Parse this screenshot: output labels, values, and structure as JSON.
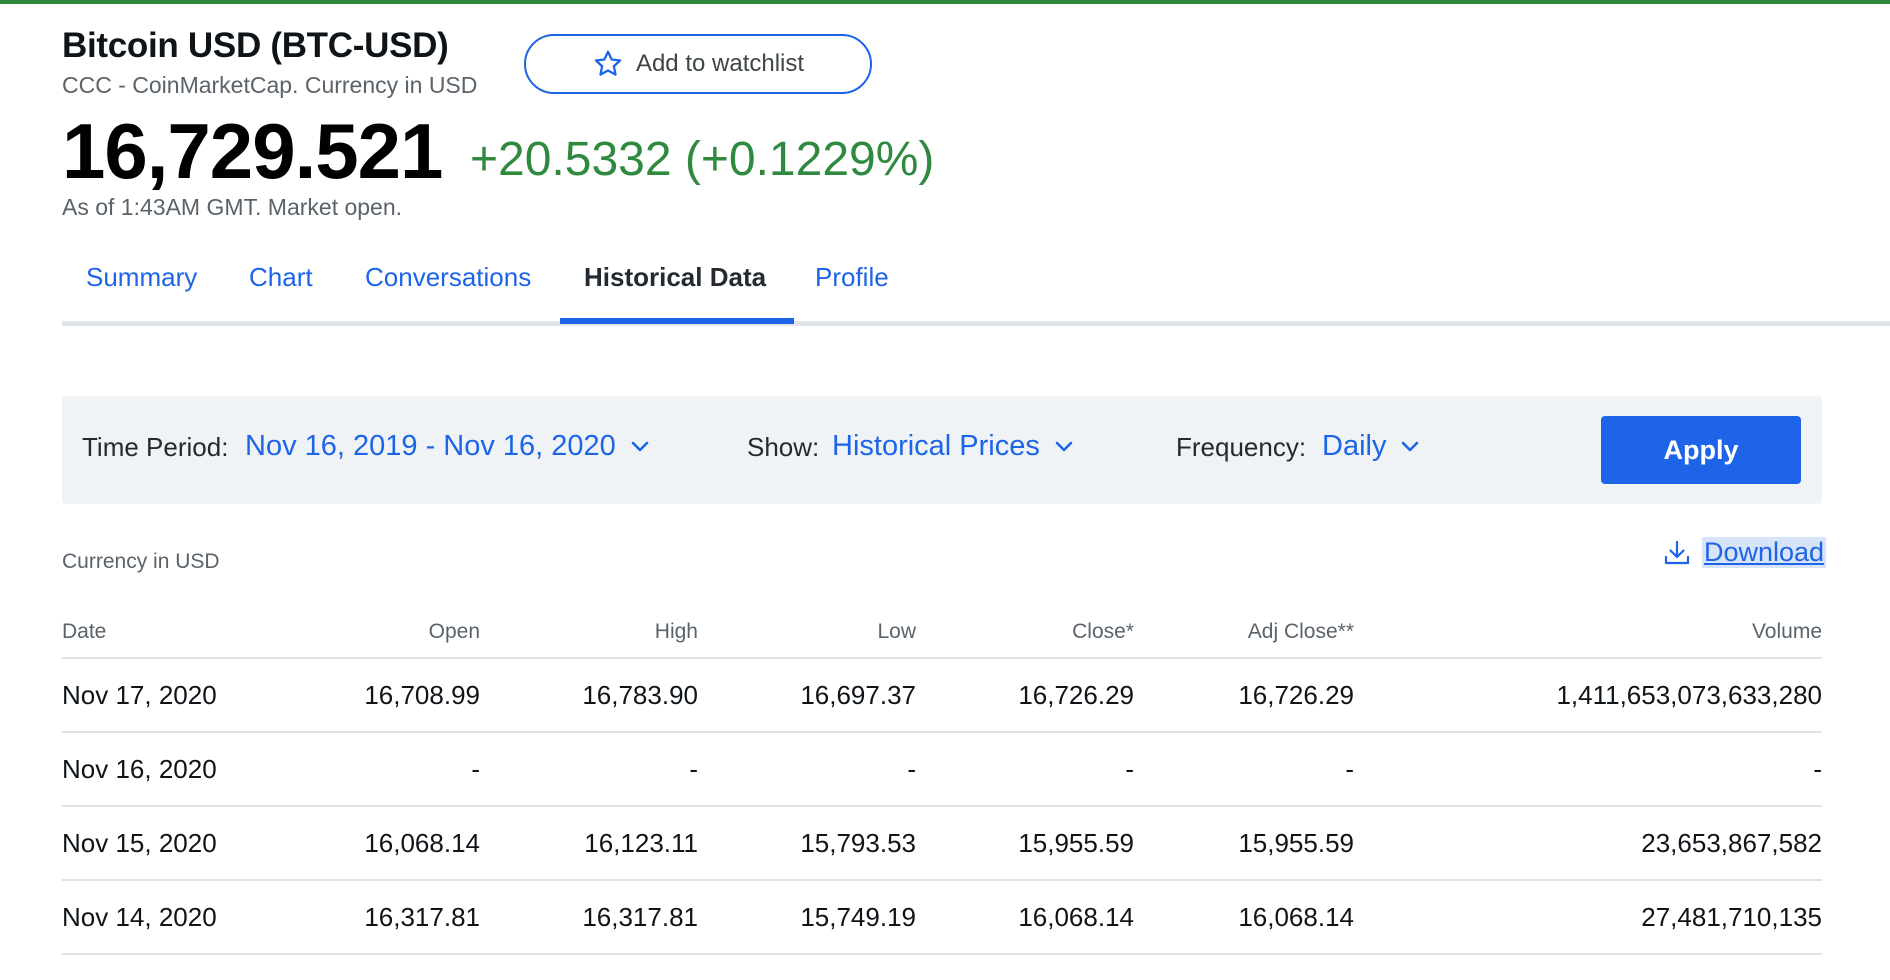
{
  "header": {
    "title": "Bitcoin USD (BTC-USD)",
    "exchange": "CCC - CoinMarketCap. Currency in USD",
    "watchlist_label": "Add to watchlist",
    "price": "16,729.521",
    "change": "+20.5332 (+0.1229%)",
    "as_of": "As of 1:43AM GMT. Market open."
  },
  "tabs": [
    {
      "label": "Summary"
    },
    {
      "label": "Chart"
    },
    {
      "label": "Conversations"
    },
    {
      "label": "Historical Data",
      "active": true
    },
    {
      "label": "Profile"
    }
  ],
  "filters": {
    "time_period_label": "Time Period:",
    "time_period_value": "Nov 16, 2019 - Nov 16, 2020",
    "show_label": "Show:",
    "show_value": "Historical Prices",
    "frequency_label": "Frequency:",
    "frequency_value": "Daily",
    "apply_label": "Apply"
  },
  "currency_note": "Currency in USD",
  "download_label": "Download",
  "icons": {
    "watchlist": "star-icon",
    "dropdown": "chevron-down-icon",
    "download": "download-icon"
  },
  "colors": {
    "accent": "#1d64e8",
    "positive": "#2f8a3f",
    "top_border": "#2f8a3f",
    "filter_bg": "#f0f3f5"
  },
  "table": {
    "columns": [
      "Date",
      "Open",
      "High",
      "Low",
      "Close*",
      "Adj Close**",
      "Volume"
    ],
    "rows": [
      [
        "Nov 17, 2020",
        "16,708.99",
        "16,783.90",
        "16,697.37",
        "16,726.29",
        "16,726.29",
        "1,411,653,073,633,280"
      ],
      [
        "Nov 16, 2020",
        "-",
        "-",
        "-",
        "-",
        "-",
        "-"
      ],
      [
        "Nov 15, 2020",
        "16,068.14",
        "16,123.11",
        "15,793.53",
        "15,955.59",
        "15,955.59",
        "23,653,867,582"
      ],
      [
        "Nov 14, 2020",
        "16,317.81",
        "16,317.81",
        "15,749.19",
        "16,068.14",
        "16,068.14",
        "27,481,710,135"
      ]
    ]
  }
}
